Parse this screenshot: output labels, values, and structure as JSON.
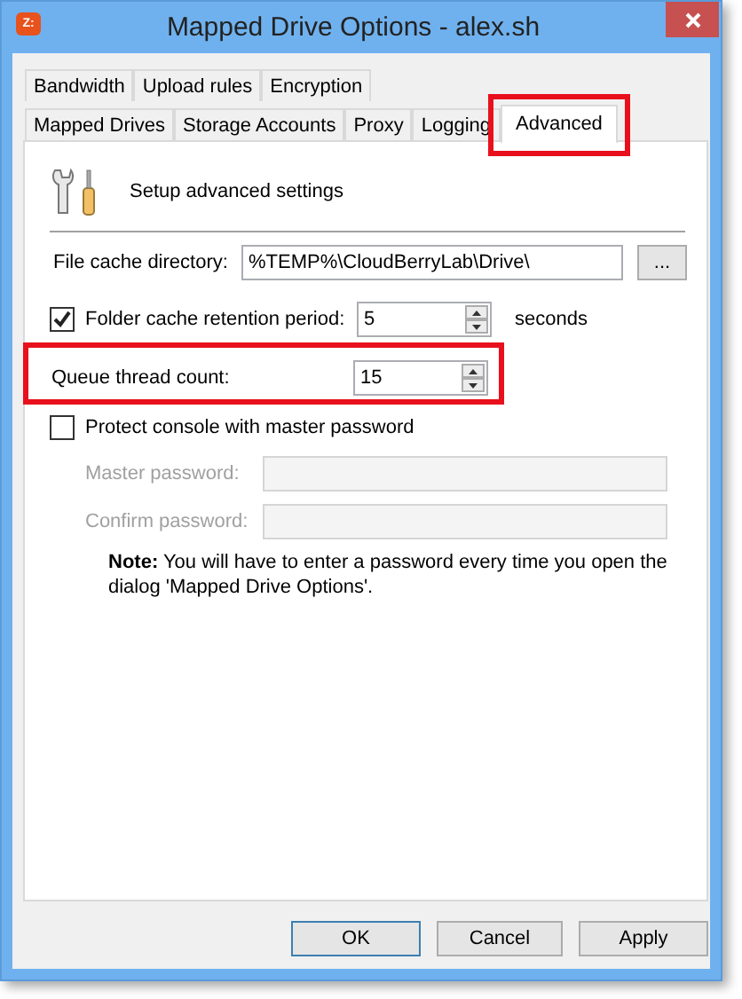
{
  "window": {
    "title": "Mapped Drive Options - alex.sh",
    "app_icon": "Z:"
  },
  "tab_rows": [
    [
      {
        "label": "Bandwidth",
        "selected": false,
        "highlighted": false
      },
      {
        "label": "Upload rules",
        "selected": false,
        "highlighted": false
      },
      {
        "label": "Encryption",
        "selected": false,
        "highlighted": false
      }
    ],
    [
      {
        "label": "Mapped Drives",
        "selected": false,
        "highlighted": false
      },
      {
        "label": "Storage Accounts",
        "selected": false,
        "highlighted": false
      },
      {
        "label": "Proxy",
        "selected": false,
        "highlighted": false
      },
      {
        "label": "Logging",
        "selected": false,
        "highlighted": false
      },
      {
        "label": "Advanced",
        "selected": true,
        "highlighted": true
      }
    ]
  ],
  "header": "Setup advanced settings",
  "file_cache": {
    "label": "File cache directory:",
    "value": "%TEMP%\\CloudBerryLab\\Drive\\",
    "browse": "..."
  },
  "folder_cache": {
    "label": "Folder cache retention period:",
    "checked": true,
    "value": "5",
    "unit": "seconds"
  },
  "queue": {
    "label": "Queue thread count:",
    "value": "15",
    "highlighted": true
  },
  "protect": {
    "label": "Protect console with master password",
    "checked": false
  },
  "passwords": [
    {
      "label": "Master password:",
      "disabled": true
    },
    {
      "label": "Confirm password:",
      "disabled": true
    }
  ],
  "note": "**Note:**  You will have to enter a password every time you open the dialog 'Mapped Drive Options'.",
  "buttons": [
    {
      "label": "OK",
      "default": true
    },
    {
      "label": "Cancel",
      "default": false
    },
    {
      "label": "Apply",
      "default": false
    }
  ]
}
